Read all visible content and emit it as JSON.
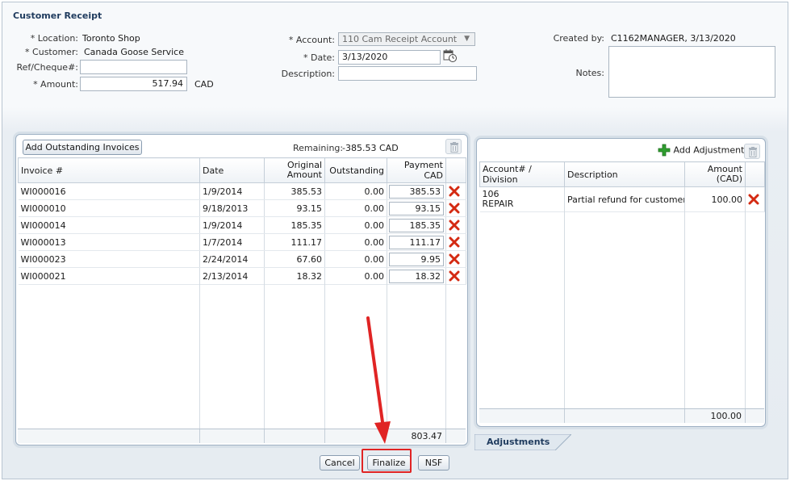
{
  "page": {
    "title": "Customer Receipt"
  },
  "form": {
    "location_label": "* Location:",
    "location_value": "Toronto Shop",
    "customer_label": "* Customer:",
    "customer_value": "Canada Goose Service",
    "ref_label": "Ref/Cheque#:",
    "ref_value": "",
    "amount_label": "* Amount:",
    "amount_value": "517.94",
    "amount_currency": "CAD",
    "account_label": "* Account:",
    "account_value": "110 Cam Receipt Account",
    "date_label": "* Date:",
    "date_value": "3/13/2020",
    "description_label": "Description:",
    "description_value": "",
    "created_by_label": "Created by:",
    "created_by_value": "C1162MANAGER, 3/13/2020",
    "notes_label": "Notes:",
    "notes_value": ""
  },
  "invoices": {
    "add_button": "Add Outstanding Invoices",
    "remaining_label": "Remaining:",
    "remaining_value": "-385.53",
    "remaining_currency": "CAD",
    "columns": [
      "Invoice #",
      "Date",
      "Original Amount",
      "Outstanding",
      "Payment CAD"
    ],
    "rows": [
      {
        "invoice": "WI000016",
        "date": "1/9/2014",
        "original": "385.53",
        "outstanding": "0.00",
        "payment": "385.53"
      },
      {
        "invoice": "WI000010",
        "date": "9/18/2013",
        "original": "93.15",
        "outstanding": "0.00",
        "payment": "93.15"
      },
      {
        "invoice": "WI000014",
        "date": "1/9/2014",
        "original": "185.35",
        "outstanding": "0.00",
        "payment": "185.35"
      },
      {
        "invoice": "WI000013",
        "date": "1/7/2014",
        "original": "111.17",
        "outstanding": "0.00",
        "payment": "111.17"
      },
      {
        "invoice": "WI000023",
        "date": "2/24/2014",
        "original": "67.60",
        "outstanding": "0.00",
        "payment": "9.95"
      },
      {
        "invoice": "WI000021",
        "date": "2/13/2014",
        "original": "18.32",
        "outstanding": "0.00",
        "payment": "18.32"
      }
    ],
    "total": "803.47"
  },
  "adjustments": {
    "add_button": "Add Adjustment",
    "columns": [
      "Account# / Division",
      "Description",
      "Amount (CAD)"
    ],
    "rows": [
      {
        "account": "106",
        "division": "REPAIR",
        "description": "Partial refund for customer ...",
        "amount": "100.00"
      }
    ],
    "total": "100.00",
    "tab_label": "Adjustments"
  },
  "footer": {
    "cancel": "Cancel",
    "finalize": "Finalize",
    "nsf": "NSF"
  },
  "colors": {
    "title": "#1f3b5e",
    "delete_icon": "#d42a12",
    "add_icon": "#2f9e2f",
    "annotation": "#e02424"
  }
}
